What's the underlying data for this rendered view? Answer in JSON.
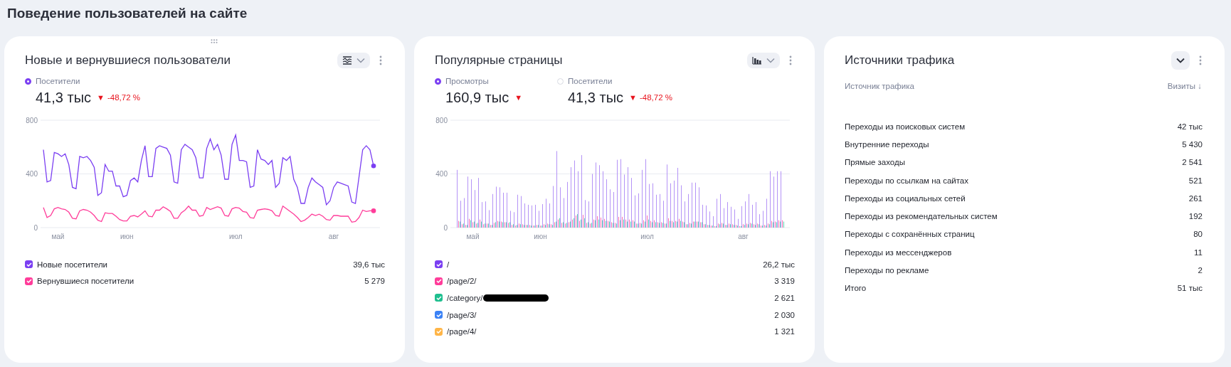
{
  "page_title": "Поведение пользователей на сайте",
  "cards": [
    {
      "kind": "chart",
      "title": "Новые и вернувшиеся пользователи",
      "drag_handle": true,
      "metrics": [
        {
          "label": "Посетители",
          "selected": true,
          "value": "41,3 тыс",
          "trend": "▼",
          "delta": "-48,72 %"
        }
      ],
      "chart_data": {
        "type": "line",
        "ylim": [
          0,
          800
        ],
        "yticks": [
          0,
          400,
          800
        ],
        "categories": [
          null,
          null,
          null,
          null,
          "май",
          null,
          null,
          null,
          null,
          null,
          null,
          null,
          null,
          null,
          null,
          null,
          null,
          null,
          null,
          null,
          null,
          null,
          null,
          "июн",
          null,
          null,
          null,
          null,
          null,
          null,
          null,
          null,
          null,
          null,
          null,
          null,
          null,
          null,
          null,
          null,
          null,
          null,
          null,
          null,
          null,
          null,
          null,
          null,
          null,
          null,
          null,
          null,
          null,
          "июл",
          null,
          null,
          null,
          null,
          null,
          null,
          null,
          null,
          null,
          null,
          null,
          null,
          null,
          null,
          null,
          null,
          null,
          null,
          null,
          null,
          null,
          null,
          null,
          null,
          null,
          null,
          "авг",
          null,
          null,
          null,
          null,
          null,
          null,
          null,
          null,
          null,
          null,
          null
        ],
        "series": [
          {
            "color": "#7b3ff2",
            "values": [
              580,
              340,
              350,
              560,
              550,
              530,
              550,
              470,
              300,
              290,
              530,
              520,
              530,
              500,
              450,
              240,
              260,
              470,
              420,
              420,
              310,
              310,
              230,
              240,
              350,
              370,
              340,
              500,
              610,
              380,
              380,
              590,
              610,
              600,
              590,
              540,
              340,
              330,
              580,
              620,
              600,
              580,
              520,
              370,
              370,
              590,
              660,
              580,
              620,
              540,
              360,
              360,
              620,
              690,
              500,
              500,
              490,
              300,
              310,
              580,
              510,
              500,
              470,
              500,
              300,
              330,
              520,
              500,
              530,
              360,
              300,
              180,
              180,
              300,
              370,
              340,
              320,
              300,
              170,
              200,
              300,
              340,
              330,
              320,
              310,
              190,
              180,
              380,
              580,
              610,
              580,
              460
            ]
          },
          {
            "color": "#ff3d9a",
            "values": [
              150,
              75,
              90,
              140,
              150,
              140,
              135,
              115,
              70,
              65,
              125,
              135,
              130,
              115,
              90,
              55,
              45,
              110,
              105,
              105,
              85,
              60,
              50,
              50,
              85,
              90,
              80,
              100,
              125,
              85,
              80,
              130,
              130,
              155,
              140,
              120,
              70,
              70,
              110,
              130,
              160,
              130,
              130,
              85,
              90,
              150,
              135,
              145,
              155,
              145,
              90,
              85,
              140,
              150,
              145,
              120,
              115,
              75,
              70,
              130,
              135,
              140,
              135,
              125,
              90,
              85,
              160,
              140,
              120,
              100,
              75,
              45,
              55,
              75,
              100,
              90,
              100,
              85,
              60,
              55,
              90,
              90,
              85,
              85,
              85,
              40,
              45,
              75,
              130,
              120,
              125,
              125
            ]
          }
        ]
      },
      "legend": [
        {
          "label": "Новые посетители",
          "value": "39,6 тыс",
          "checked": true,
          "color": "#7b3ff2"
        },
        {
          "label": "Вернувшиеся посетители",
          "value": "5 279",
          "checked": true,
          "color": "#ff3d9a"
        }
      ]
    },
    {
      "kind": "chart",
      "title": "Популярные страницы",
      "drag_handle": false,
      "metrics": [
        {
          "label": "Просмотры",
          "selected": true,
          "value": "160,9 тыс",
          "trend": "▼"
        },
        {
          "label": "Посетители",
          "selected": false,
          "value": "41,3 тыс",
          "trend": "▼",
          "delta": "-48,72 %"
        }
      ],
      "chart_data": {
        "type": "bar",
        "ylim": [
          0,
          800
        ],
        "yticks": [
          0,
          400,
          800
        ],
        "categories": [
          null,
          null,
          null,
          null,
          "май",
          null,
          null,
          null,
          null,
          null,
          null,
          null,
          null,
          null,
          null,
          null,
          null,
          null,
          null,
          null,
          null,
          null,
          null,
          "июн",
          null,
          null,
          null,
          null,
          null,
          null,
          null,
          null,
          null,
          null,
          null,
          null,
          null,
          null,
          null,
          null,
          null,
          null,
          null,
          null,
          null,
          null,
          null,
          null,
          null,
          null,
          null,
          null,
          null,
          "июл",
          null,
          null,
          null,
          null,
          null,
          null,
          null,
          null,
          null,
          null,
          null,
          null,
          null,
          null,
          null,
          null,
          null,
          null,
          null,
          null,
          null,
          null,
          null,
          null,
          null,
          null,
          "авг",
          null,
          null,
          null,
          null,
          null,
          null,
          null,
          null,
          null,
          null,
          null
        ],
        "series": [
          {
            "color": "#b493f6",
            "values": [
              430,
              200,
              220,
              380,
              360,
              280,
              370,
              190,
              195,
              130,
              250,
              305,
              300,
              260,
              260,
              125,
              115,
              245,
              235,
              180,
              170,
              165,
              170,
              125,
              175,
              215,
              180,
              310,
              570,
              300,
              220,
              340,
              450,
              500,
              420,
              540,
              205,
              195,
              400,
              485,
              465,
              420,
              360,
              285,
              265,
              505,
              510,
              395,
              450,
              370,
              240,
              255,
              430,
              510,
              325,
              330,
              245,
              250,
              200,
              470,
              330,
              350,
              445,
              315,
              195,
              250,
              335,
              335,
              300,
              170,
              165,
              120,
              85,
              215,
              250,
              145,
              190,
              155,
              135,
              65,
              160,
              195,
              250,
              170,
              190,
              100,
              125,
              215,
              420,
              380,
              420,
              420
            ]
          },
          {
            "color": "#ff6fb3",
            "values": [
              50,
              25,
              20,
              65,
              40,
              30,
              60,
              25,
              30,
              20,
              35,
              50,
              45,
              40,
              35,
              20,
              15,
              30,
              25,
              20,
              20,
              15,
              20,
              15,
              25,
              30,
              25,
              40,
              60,
              35,
              30,
              40,
              60,
              90,
              50,
              95,
              35,
              30,
              60,
              85,
              75,
              65,
              50,
              40,
              35,
              80,
              80,
              60,
              60,
              55,
              30,
              35,
              55,
              90,
              50,
              55,
              40,
              40,
              30,
              70,
              50,
              50,
              65,
              45,
              25,
              35,
              45,
              45,
              40,
              25,
              20,
              15,
              10,
              30,
              35,
              20,
              30,
              25,
              20,
              10,
              25,
              30,
              35,
              25,
              30,
              15,
              20,
              30,
              50,
              45,
              55,
              55
            ]
          },
          {
            "color": "#5fd6b4",
            "values": [
              45,
              30,
              20,
              55,
              45,
              35,
              45,
              30,
              30,
              20,
              40,
              45,
              40,
              40,
              40,
              25,
              20,
              25,
              20,
              20,
              15,
              15,
              20,
              15,
              20,
              25,
              20,
              45,
              70,
              40,
              35,
              45,
              70,
              100,
              60,
              70,
              40,
              35,
              55,
              60,
              55,
              50,
              45,
              35,
              30,
              55,
              60,
              45,
              45,
              45,
              30,
              30,
              45,
              60,
              40,
              40,
              35,
              35,
              30,
              50,
              40,
              45,
              50,
              40,
              25,
              30,
              45,
              45,
              40,
              25,
              20,
              15,
              10,
              25,
              30,
              20,
              25,
              20,
              15,
              10,
              20,
              25,
              30,
              20,
              25,
              15,
              15,
              25,
              40,
              40,
              45,
              45
            ]
          }
        ]
      },
      "legend": [
        {
          "label": "/",
          "value": "26,2 тыс",
          "checked": true,
          "color": "#7b3ff2"
        },
        {
          "label": "/page/2/",
          "value": "3 319",
          "checked": true,
          "color": "#ff3d9a"
        },
        {
          "label": "/category/",
          "value": "2 621",
          "checked": true,
          "color": "#1fbf8f",
          "redacted": true
        },
        {
          "label": "/page/3/",
          "value": "2 030",
          "checked": true,
          "color": "#3b82f6"
        },
        {
          "label": "/page/4/",
          "value": "1 321",
          "checked": true,
          "color": "#ffb547"
        }
      ]
    },
    {
      "kind": "table",
      "title": "Источники трафика",
      "drag_handle": false,
      "columns": [
        "Источник трафика",
        "Визиты ↓"
      ],
      "rows": [
        [
          "Переходы из поисковых систем",
          "42 тыс"
        ],
        [
          "Внутренние переходы",
          "5 430"
        ],
        [
          "Прямые заходы",
          "2 541"
        ],
        [
          "Переходы по ссылкам на сайтах",
          "521"
        ],
        [
          "Переходы из социальных сетей",
          "261"
        ],
        [
          "Переходы из рекомендательных систем",
          "192"
        ],
        [
          "Переходы с сохранённых страниц",
          "80"
        ],
        [
          "Переходы из мессенджеров",
          "11"
        ],
        [
          "Переходы по рекламе",
          "2"
        ]
      ],
      "total": [
        "Итого",
        "51 тыс"
      ]
    }
  ]
}
